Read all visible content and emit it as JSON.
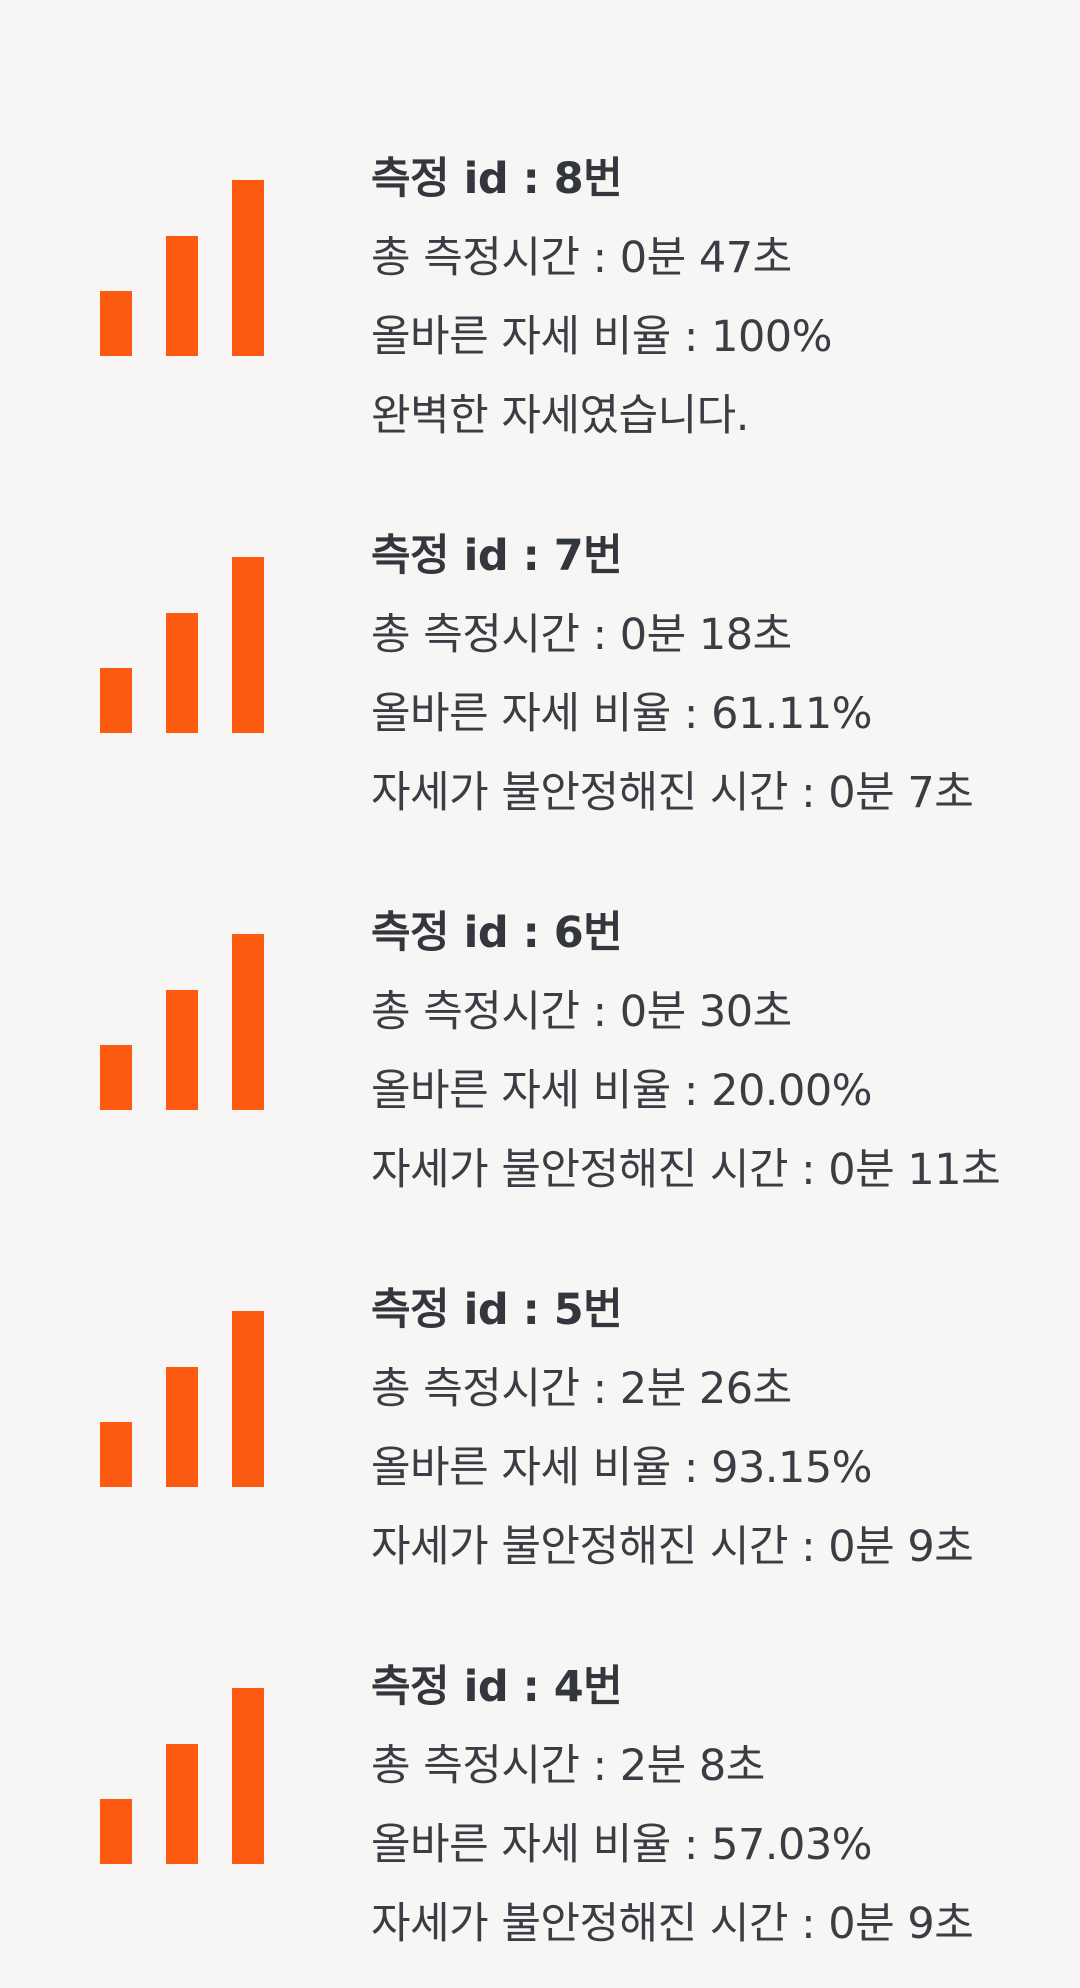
{
  "accent_color": "#fc5911",
  "icons": {
    "record_icon": "bar-chart-icon"
  },
  "records": [
    {
      "title": "측정 id : 8번",
      "total_time": "총 측정시간 : 0분 47초",
      "correct_ratio": "올바른 자세 비율 : 100%",
      "extra": "완벽한 자세였습니다."
    },
    {
      "title": "측정 id : 7번",
      "total_time": "총 측정시간 : 0분 18초",
      "correct_ratio": "올바른 자세 비율 : 61.11%",
      "extra": "자세가 불안정해진 시간 : 0분 7초"
    },
    {
      "title": "측정 id : 6번",
      "total_time": "총 측정시간 : 0분 30초",
      "correct_ratio": "올바른 자세 비율 : 20.00%",
      "extra": "자세가 불안정해진 시간 : 0분 11초"
    },
    {
      "title": "측정 id : 5번",
      "total_time": "총 측정시간 : 2분 26초",
      "correct_ratio": "올바른 자세 비율 : 93.15%",
      "extra": "자세가 불안정해진 시간 : 0분 9초"
    },
    {
      "title": "측정 id : 4번",
      "total_time": "총 측정시간 : 2분 8초",
      "correct_ratio": "올바른 자세 비율 : 57.03%",
      "extra": "자세가 불안정해진 시간 : 0분 9초"
    }
  ]
}
